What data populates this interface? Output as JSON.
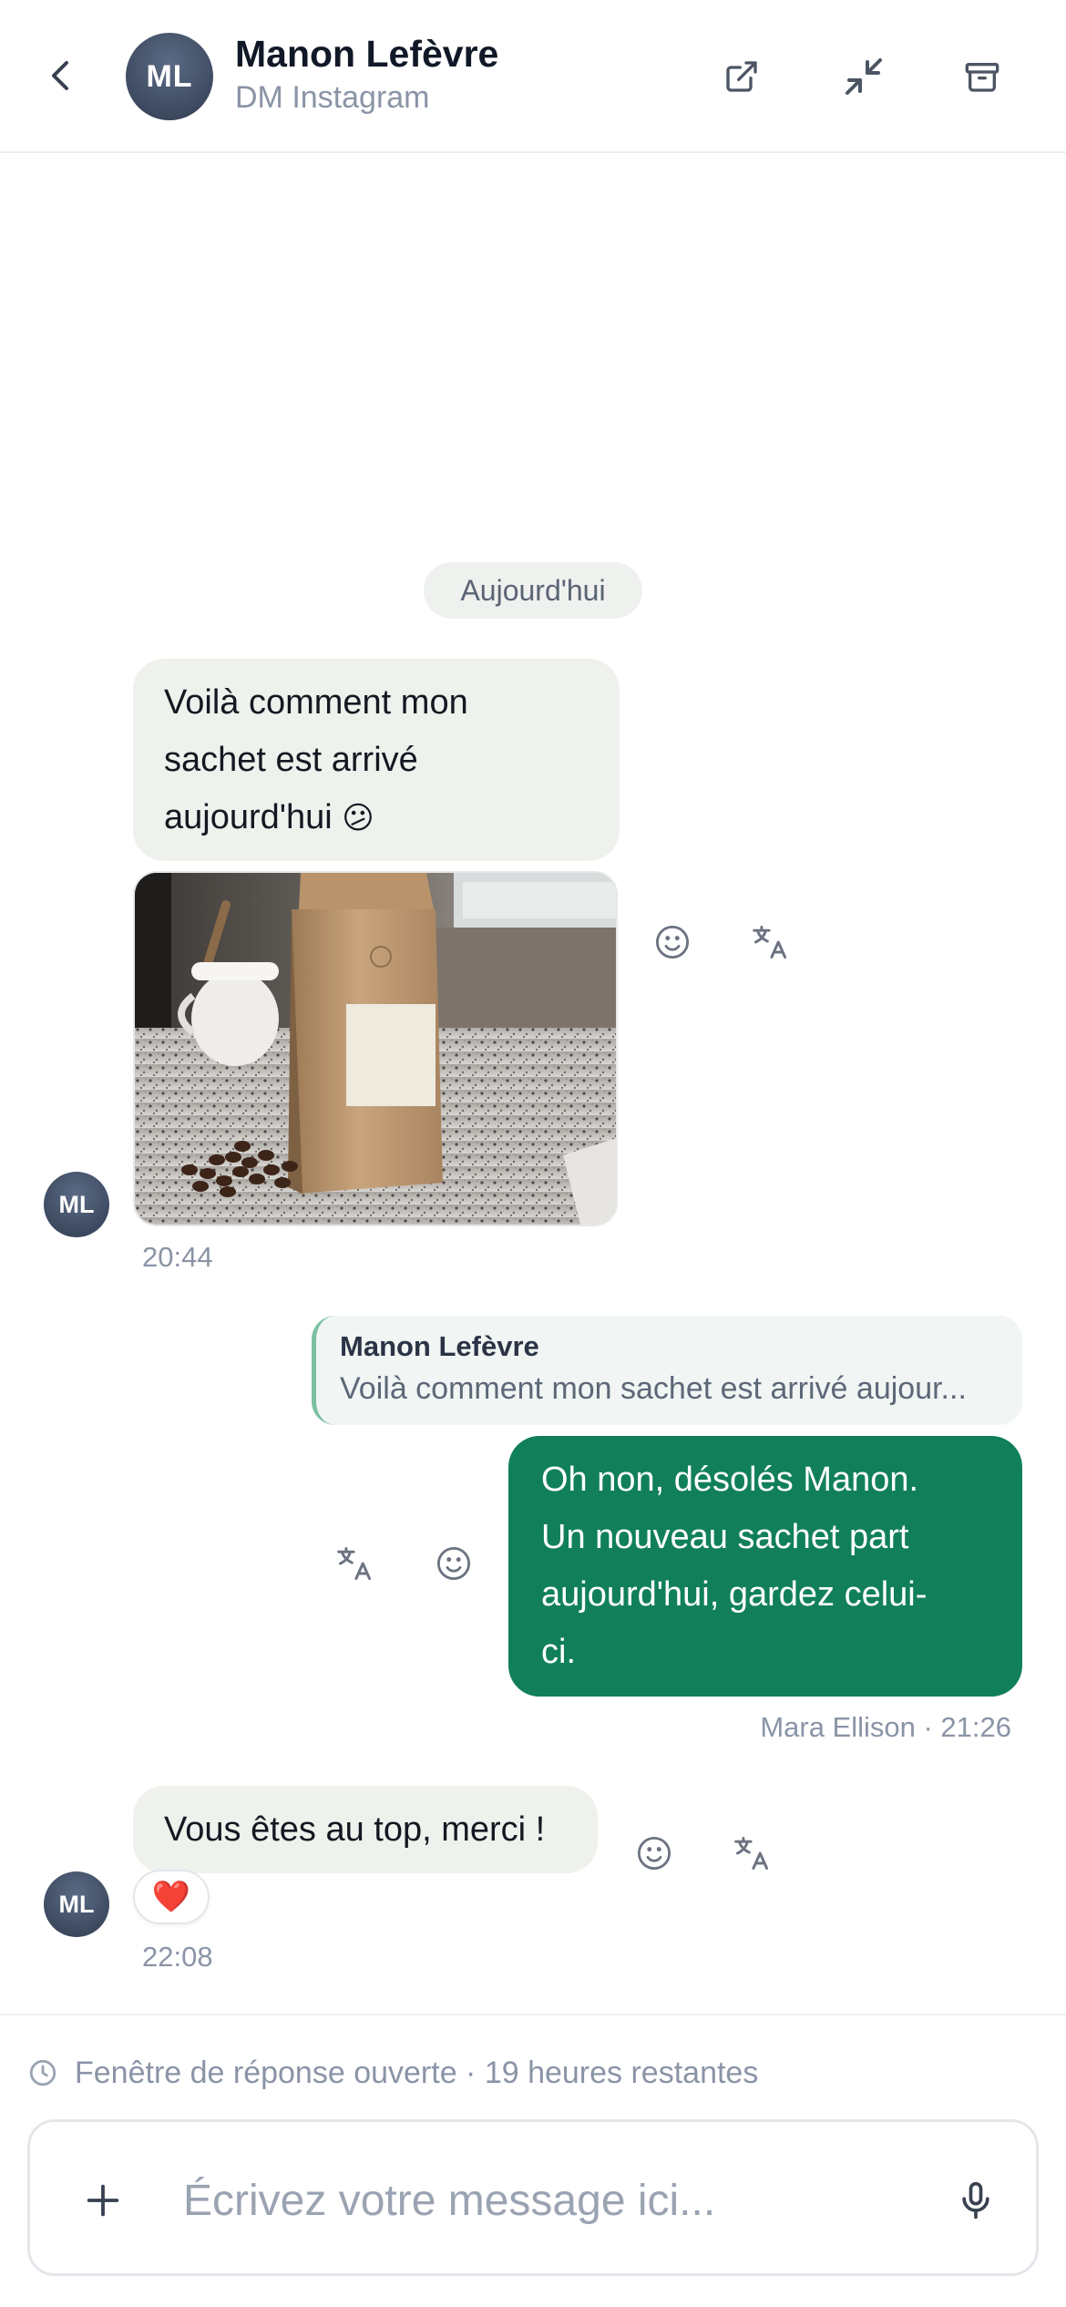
{
  "header": {
    "avatar_initials": "ML",
    "contact_name": "Manon Lefèvre",
    "channel": "DM Instagram",
    "icons": [
      "chevron-left-icon",
      "external-link-icon",
      "minimize-icon",
      "archive-icon"
    ]
  },
  "conversation": {
    "day_label": "Aujourd'hui",
    "messages": [
      {
        "direction": "incoming",
        "avatar_initials": "ML",
        "lines": [
          "Voilà comment mon",
          "sachet est arrivé",
          "aujourd'hui"
        ],
        "emoji": "😕",
        "has_image": true,
        "image_subject": "coffee bag on granite counter",
        "time": "20:44"
      },
      {
        "direction": "outgoing",
        "reply_to": {
          "name": "Manon Lefèvre",
          "text": "Voilà comment mon sachet est arrivé aujour..."
        },
        "lines": [
          "Oh non, désolés Manon.",
          "Un nouveau sachet part",
          "aujourd'hui, gardez celui-",
          "ci."
        ],
        "meta": "Mara Ellison · 21:26"
      },
      {
        "direction": "incoming",
        "avatar_initials": "ML",
        "text": "Vous êtes au top, merci !",
        "reaction": "❤️",
        "time": "22:08"
      }
    ]
  },
  "footer": {
    "window_note": "Fenêtre de réponse ouverte · 19 heures restantes",
    "composer_placeholder": "Écrivez votre message ici..."
  },
  "colors": {
    "outgoing_bubble": "#11805a",
    "incoming_bubble": "#eef1ec",
    "muted_text": "#8a94a6",
    "quote_accent": "#7cbfa1"
  }
}
